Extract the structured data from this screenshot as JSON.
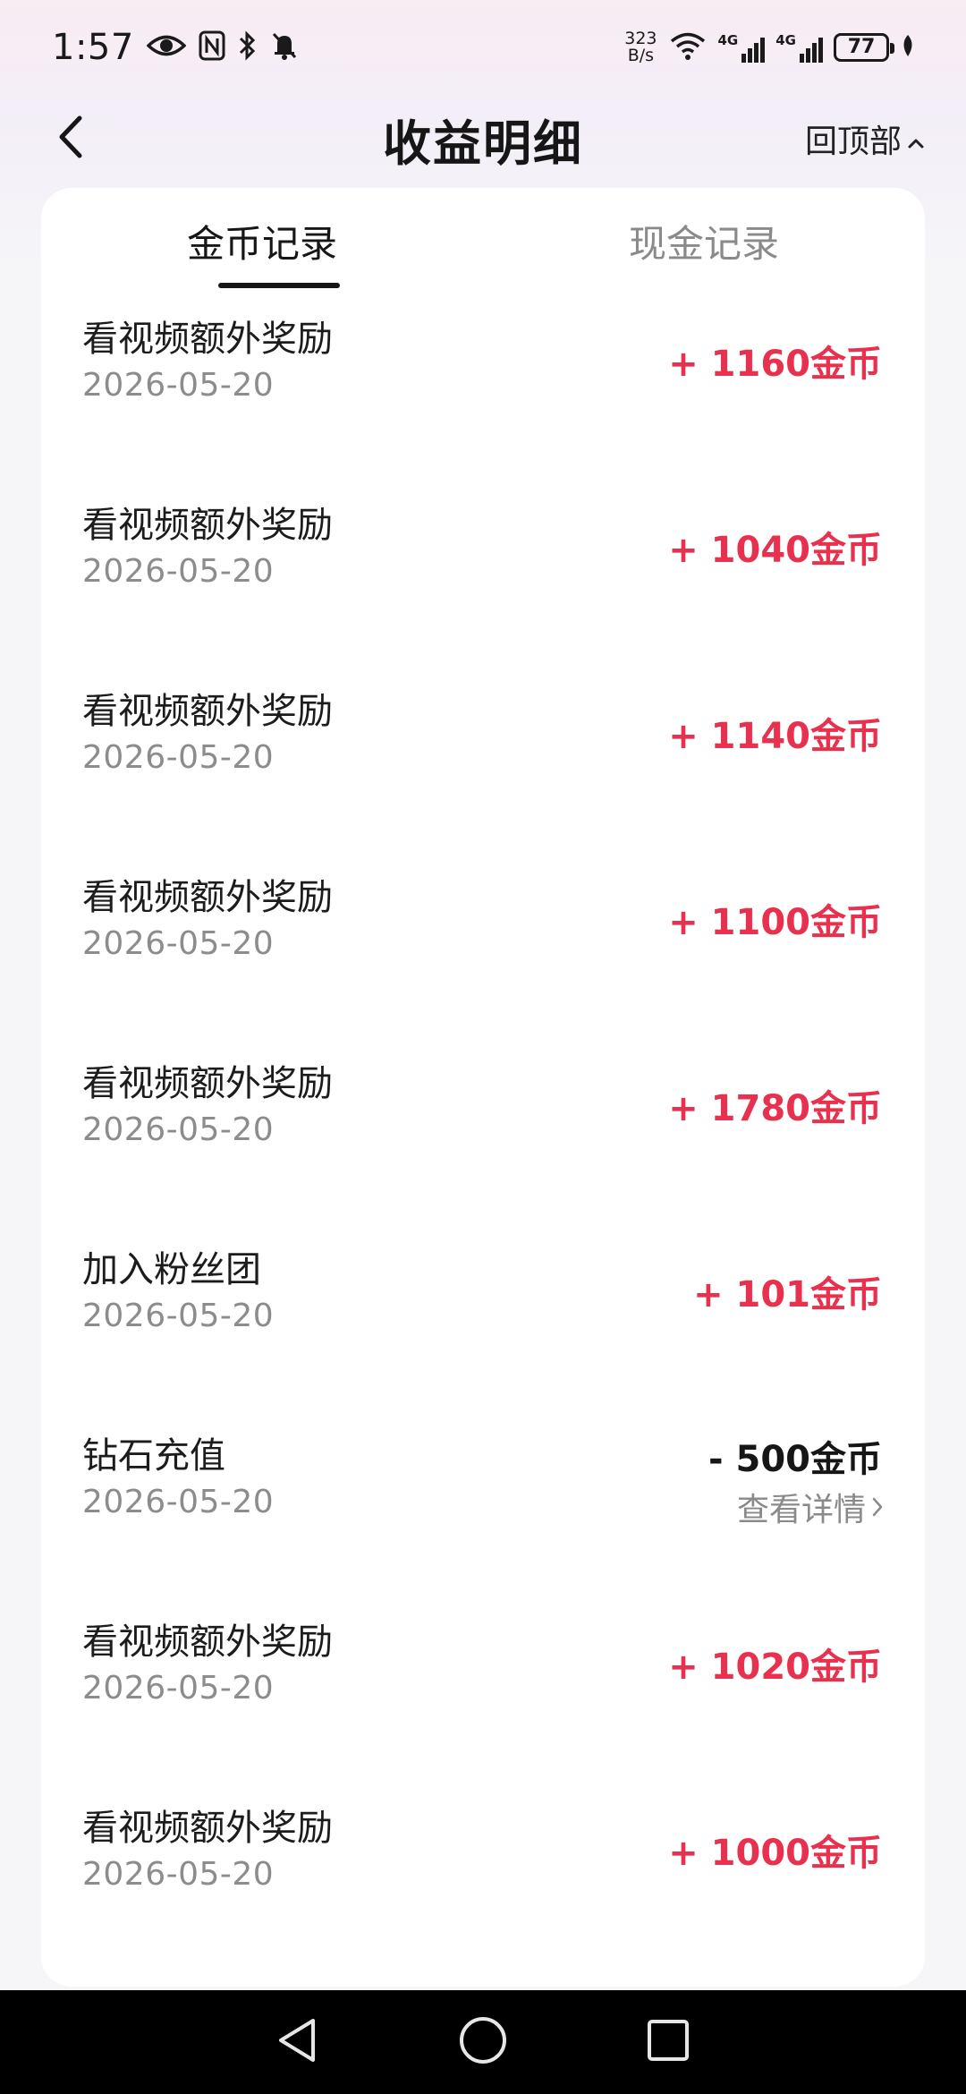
{
  "status_bar": {
    "time": "1:57",
    "net_speed_value": "323",
    "net_speed_unit": "B/s",
    "sim1_label": "4G",
    "sim2_label": "4G",
    "battery": "77"
  },
  "header": {
    "title": "收益明细",
    "back_to_top": "回顶部"
  },
  "tabs": [
    {
      "label": "金币记录",
      "active": true
    },
    {
      "label": "现金记录",
      "active": false
    }
  ],
  "records": [
    {
      "name": "看视频额外奖励",
      "date": "2026-05-20",
      "amount": "+ 1160金币"
    },
    {
      "name": "看视频额外奖励",
      "date": "2026-05-20",
      "amount": "+ 1040金币"
    },
    {
      "name": "看视频额外奖励",
      "date": "2026-05-20",
      "amount": "+ 1140金币"
    },
    {
      "name": "看视频额外奖励",
      "date": "2026-05-20",
      "amount": "+ 1100金币"
    },
    {
      "name": "看视频额外奖励",
      "date": "2026-05-20",
      "amount": "+ 1780金币"
    },
    {
      "name": "加入粉丝团",
      "date": "2026-05-20",
      "amount": "+ 101金币"
    },
    {
      "name": "钻石充值",
      "date": "2026-05-20",
      "amount": "- 500金币",
      "detail_link": "查看详情"
    },
    {
      "name": "看视频额外奖励",
      "date": "2026-05-20",
      "amount": "+ 1020金币"
    },
    {
      "name": "看视频额外奖励",
      "date": "2026-05-20",
      "amount": "+ 1000金币"
    }
  ],
  "colors": {
    "income": "#e8304f",
    "expense": "#161616",
    "secondary_text": "#8c8c8c"
  }
}
